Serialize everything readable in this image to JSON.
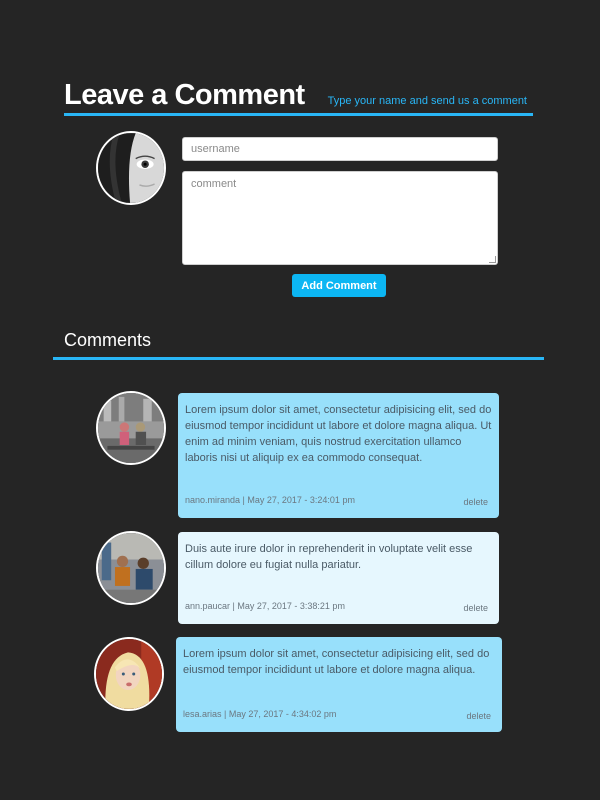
{
  "form": {
    "title": "Leave a Comment",
    "subtitle": "Type your name and send us a comment",
    "username_placeholder": "username",
    "comment_placeholder": "comment",
    "add_button": "Add Comment"
  },
  "comments_section": {
    "title": "Comments",
    "items": [
      {
        "text": "Lorem ipsum dolor sit amet, consectetur adipisicing elit, sed do eiusmod tempor incididunt ut labore et dolore magna aliqua. Ut enim ad minim veniam, quis nostrud exercitation ullamco laboris nisi ut aliquip ex ea commodo consequat.",
        "meta": "nano.miranda | May 27, 2017 - 3:24:01 pm",
        "delete": "delete"
      },
      {
        "text": "Duis aute irure dolor in reprehenderit in voluptate velit esse cillum dolore eu fugiat nulla pariatur.",
        "meta": "ann.paucar | May 27, 2017 - 3:38:21 pm",
        "delete": "delete"
      },
      {
        "text": "Lorem ipsum dolor sit amet, consectetur adipisicing elit, sed do eiusmod tempor incididunt ut labore et dolore magna aliqua.",
        "meta": "lesa.arias | May 27, 2017 - 4:34:02 pm",
        "delete": "delete"
      }
    ]
  },
  "colors": {
    "background": "#252525",
    "accent": "#29b6f6",
    "button": "#0cb6f3",
    "card_blue": "#98e0fb",
    "card_pale": "#e6f7fe"
  },
  "icons": [
    "user-avatar-photo",
    "commenter-avatar-photo"
  ]
}
